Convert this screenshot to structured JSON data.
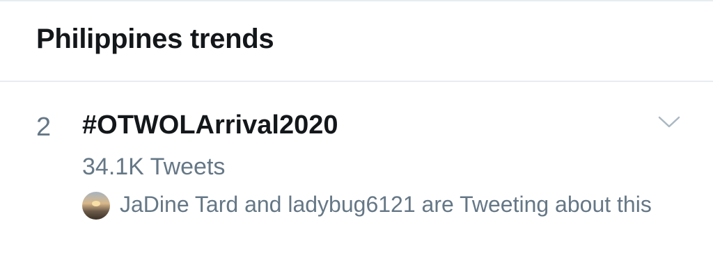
{
  "header": {
    "title": "Philippines trends"
  },
  "trend": {
    "rank": "2",
    "hashtag": "#OTWOLArrival2020",
    "tweet_count": "34.1K Tweets",
    "social_context": "JaDine Tard and ladybug6121 are Tweeting about this"
  },
  "icons": {
    "menu": "chevron-down-icon",
    "avatar": "user-avatar"
  },
  "colors": {
    "primary_text": "#14171a",
    "secondary_text": "#657786",
    "divider": "#e6ecf0",
    "chevron": "#aab8c2"
  }
}
